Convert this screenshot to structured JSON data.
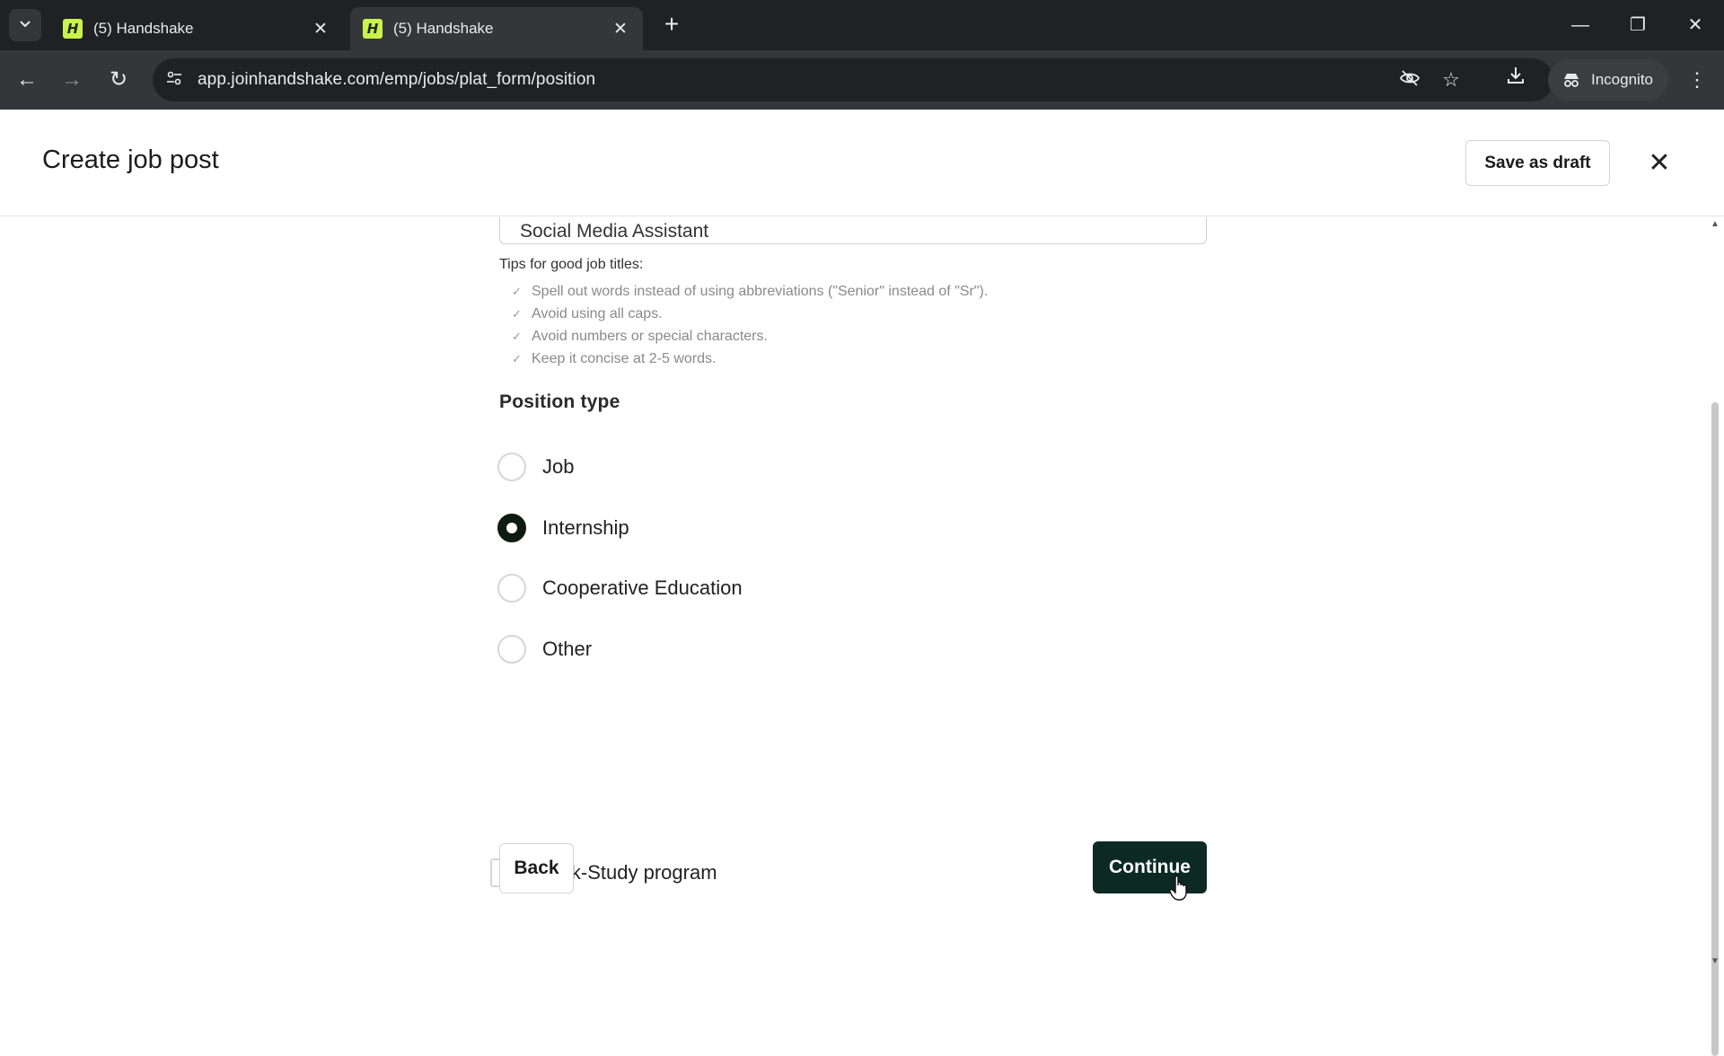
{
  "browser": {
    "tabs": [
      {
        "title": "(5) Handshake",
        "active": false,
        "favicon": "H"
      },
      {
        "title": "(5) Handshake",
        "active": true,
        "favicon": "H"
      }
    ],
    "url": "app.joinhandshake.com/emp/jobs/plat_form/position",
    "incognito_label": "Incognito"
  },
  "header": {
    "title": "Create job post",
    "save_draft_label": "Save as draft"
  },
  "job_title": {
    "value": "Social Media Assistant"
  },
  "tips": {
    "heading": "Tips for good job titles:",
    "items": [
      "Spell out words instead of using abbreviations (\"Senior\" instead of \"Sr\").",
      "Avoid using all caps.",
      "Avoid numbers or special characters.",
      "Keep it concise at 2-5 words."
    ]
  },
  "position_type": {
    "label": "Position type",
    "options": [
      {
        "label": "Job",
        "selected": false
      },
      {
        "label": "Internship",
        "selected": true
      },
      {
        "label": "Cooperative Education",
        "selected": false
      },
      {
        "label": "Other",
        "selected": false
      }
    ]
  },
  "work_study": {
    "label": "Work-Study program",
    "checked": false
  },
  "actions": {
    "back_label": "Back",
    "continue_label": "Continue"
  },
  "colors": {
    "primary_button": "#0c2a22",
    "favicon": "#c9f24a",
    "chrome_dark": "#202124"
  }
}
